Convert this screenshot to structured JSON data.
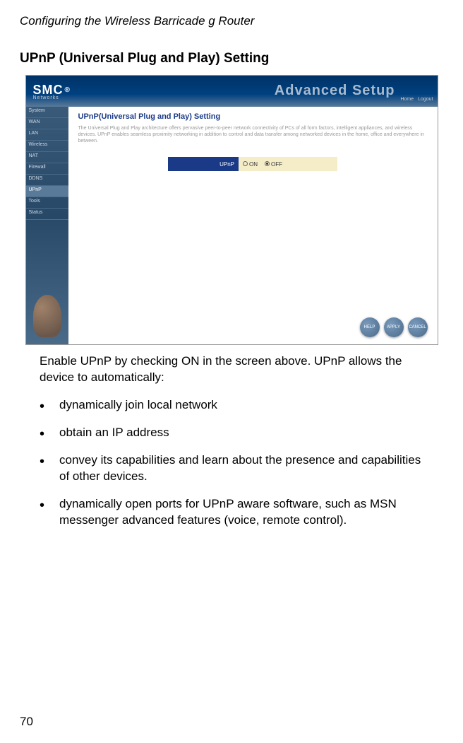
{
  "header": "Configuring the Wireless Barricade g Router",
  "section_title": "UPnP (Universal Plug and Play) Setting",
  "screenshot": {
    "logo_text": "SMC",
    "logo_reg": "®",
    "logo_sub": "Networks",
    "advanced_label": "Advanced Setup",
    "home_link": "Home",
    "logout_link": "Logout",
    "sidebar": {
      "items": [
        {
          "label": "System"
        },
        {
          "label": "WAN"
        },
        {
          "label": "LAN"
        },
        {
          "label": "Wireless"
        },
        {
          "label": "NAT"
        },
        {
          "label": "Firewall"
        },
        {
          "label": "DDNS"
        },
        {
          "label": "UPnP"
        },
        {
          "label": "Tools"
        },
        {
          "label": "Status"
        }
      ]
    },
    "main": {
      "title": "UPnP(Universal Plug and Play) Setting",
      "description": "The Universal Plug and Play architecture offers pervasive peer-to-peer network connectivity of PCs of all form factors, intelligent appliances, and wireless devices. UPnP enables seamless proximity networking in addition to control and data transfer among networked devices in the home, office and everywhere in between.",
      "control_label": "UPnP",
      "option_on": "ON",
      "option_off": "OFF"
    },
    "buttons": {
      "help": "HELP",
      "apply": "APPLY",
      "cancel": "CANCEL"
    }
  },
  "intro_text": "Enable UPnP by checking ON in the screen above. UPnP allows the device to automatically:",
  "bullets": [
    "dynamically join local network",
    "obtain an IP address",
    "convey its capabilities and learn about the presence and capabilities of other devices.",
    "dynamically open ports for UPnP aware software, such as MSN messenger advanced features (voice, remote control)."
  ],
  "page_number": "70"
}
